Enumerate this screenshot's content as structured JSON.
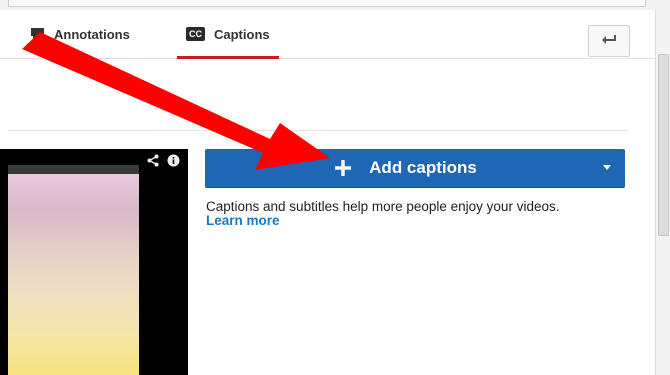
{
  "tabs": [
    {
      "label": "Annotations",
      "icon": "speech-bubble-icon",
      "active": false
    },
    {
      "label": "Captions",
      "icon": "cc-icon",
      "badge": "CC",
      "active": true
    }
  ],
  "back_button": {
    "icon": "back-arrow-icon"
  },
  "video": {
    "icons": [
      "share-icon",
      "info-icon"
    ]
  },
  "add_captions_button": {
    "label": "Add captions",
    "icon": "plus-icon",
    "dropdown_icon": "caret-down-icon",
    "color": "#1f67b5"
  },
  "help": {
    "text": "Captions and subtitles help more people enjoy your videos.",
    "link": "Learn more"
  },
  "annotation_arrow": {
    "color": "#ff0000"
  }
}
